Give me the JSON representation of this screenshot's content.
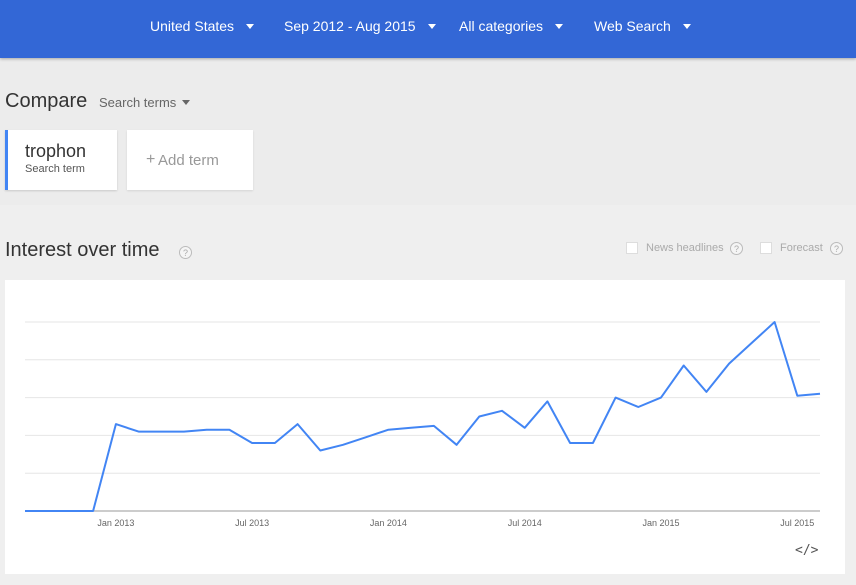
{
  "filters": [
    {
      "label": "United States"
    },
    {
      "label": "Sep 2012 - Aug 2015"
    },
    {
      "label": "All categories"
    },
    {
      "label": "Web Search"
    }
  ],
  "compare": {
    "title": "Compare",
    "mode_label": "Search terms"
  },
  "terms": [
    {
      "name": "trophon",
      "sub": "Search term",
      "color": "#4285f4"
    }
  ],
  "add_term": {
    "plus": "+",
    "label": "Add term"
  },
  "interest": {
    "title": "Interest over time",
    "help": "?",
    "options": [
      {
        "label": "News headlines",
        "checked": false
      },
      {
        "label": "Forecast",
        "checked": false
      }
    ]
  },
  "embed_label": "</>",
  "colors": {
    "header": "#3367d6",
    "series": "#4285f4",
    "background": "#ececec"
  },
  "chart_data": {
    "type": "line",
    "x_tick_labels": [
      "Jan 2013",
      "Jul 2013",
      "Jan 2014",
      "Jul 2014",
      "Jan 2015",
      "Jul 2015"
    ],
    "x_tick_months": [
      "2013-01",
      "2013-07",
      "2014-01",
      "2014-07",
      "2015-01",
      "2015-07"
    ],
    "ylim": [
      0,
      100
    ],
    "grid": true,
    "y_tick_labels_shown": false,
    "series": [
      {
        "name": "trophon",
        "x": [
          "2012-09",
          "2012-10",
          "2012-11",
          "2012-12",
          "2013-01",
          "2013-02",
          "2013-03",
          "2013-04",
          "2013-05",
          "2013-06",
          "2013-07",
          "2013-08",
          "2013-09",
          "2013-10",
          "2013-11",
          "2013-12",
          "2014-01",
          "2014-02",
          "2014-03",
          "2014-04",
          "2014-05",
          "2014-06",
          "2014-07",
          "2014-08",
          "2014-09",
          "2014-10",
          "2014-11",
          "2014-12",
          "2015-01",
          "2015-02",
          "2015-03",
          "2015-04",
          "2015-05",
          "2015-06",
          "2015-07",
          "2015-08"
        ],
        "values": [
          0,
          0,
          0,
          0,
          46,
          42,
          42,
          42,
          43,
          43,
          36,
          36,
          46,
          32,
          35,
          39,
          43,
          44,
          45,
          35,
          50,
          53,
          44,
          58,
          36,
          36,
          60,
          55,
          60,
          77,
          63,
          78,
          89,
          100,
          61,
          62
        ]
      }
    ]
  }
}
